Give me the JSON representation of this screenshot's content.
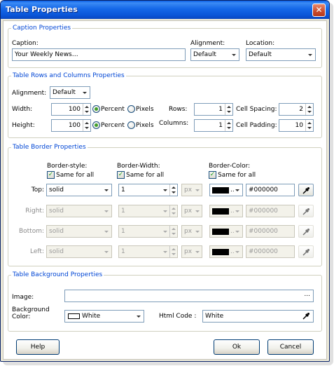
{
  "window": {
    "title": "Table Properties",
    "close_glyph": "✕"
  },
  "caption_section": {
    "legend": "Caption Properties",
    "caption_label": "Caption:",
    "caption_value": "Your Weekly News…",
    "alignment_label": "Alignment:",
    "alignment_value": "Default",
    "location_label": "Location:",
    "location_value": "Default"
  },
  "rows_section": {
    "legend": "Table Rows and Columns Properties",
    "alignment_label": "Alignment:",
    "alignment_value": "Default",
    "width_label": "Width:",
    "width_value": "100",
    "height_label": "Height:",
    "height_value": "100",
    "percent_label": "Percent",
    "pixels_label": "Pixels",
    "rows_label": "Rows:",
    "rows_value": "1",
    "columns_label": "Columns:",
    "columns_value": "1",
    "cell_spacing_label": "Cell Spacing:",
    "cell_spacing_value": "2",
    "cell_padding_label": "Cell Padding:",
    "cell_padding_value": "10"
  },
  "border_section": {
    "legend": "Table Border Properties",
    "style_header": "Border-style:",
    "width_header": "Border-Width:",
    "color_header": "Border-Color:",
    "same_for_all": "Same for all",
    "unit": "px",
    "color_dots": "..",
    "rows": [
      {
        "label": "Top:",
        "style": "solid",
        "width": "1",
        "color": "#000000",
        "enabled": true
      },
      {
        "label": "Right:",
        "style": "solid",
        "width": "1",
        "color": "#000000",
        "enabled": false
      },
      {
        "label": "Bottom:",
        "style": "solid",
        "width": "1",
        "color": "#000000",
        "enabled": false
      },
      {
        "label": "Left:",
        "style": "solid",
        "width": "1",
        "color": "#000000",
        "enabled": false
      }
    ],
    "swatch_color": "#000000"
  },
  "background_section": {
    "legend": "Table Background Properties",
    "image_label": "Image:",
    "image_value": "",
    "browse_glyph": "...",
    "bg_color_label_1": "Background",
    "bg_color_label_2": "Color:",
    "bg_color_value": "White",
    "html_code_label": "Html Code :",
    "html_code_value": "White"
  },
  "buttons": {
    "help": "Help",
    "ok": "Ok",
    "cancel": "Cancel"
  },
  "colors": {
    "title_bar": "#0a55d8",
    "legend_text": "#0046d5",
    "close_button": "#c94b2c",
    "face": "#ece9d8"
  }
}
